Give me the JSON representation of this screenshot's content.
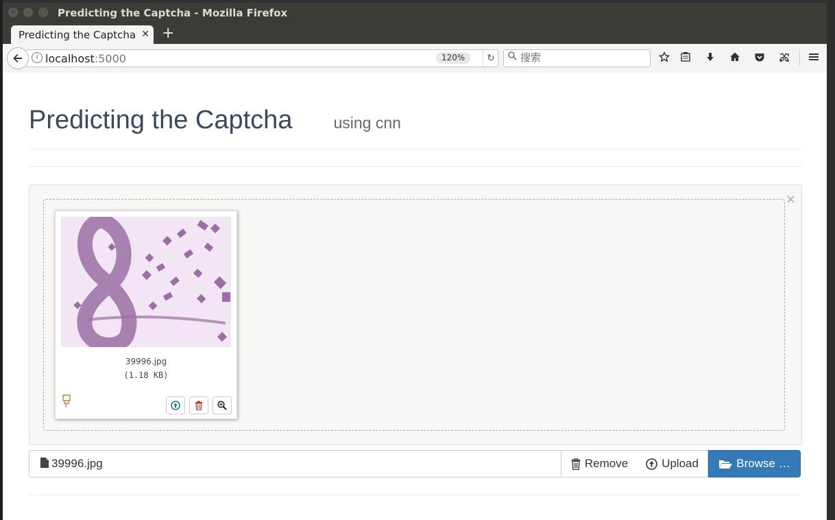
{
  "window": {
    "title": "Predicting the Captcha - Mozilla Firefox"
  },
  "tabs": [
    {
      "label": "Predicting the Captcha",
      "active": true
    }
  ],
  "navbar": {
    "url_host": "localhost",
    "url_port": ":5000",
    "zoom": "120%",
    "search_placeholder": "搜索"
  },
  "page": {
    "title": "Predicting the Captcha",
    "subtitle": "using cnn"
  },
  "preview": {
    "file_name": "39996.jpg",
    "file_size": "(1.18 KB)",
    "captcha_color": "#9b6fa3",
    "captcha_bg": "#f3e6f4"
  },
  "file_input": {
    "caption": "39996.jpg",
    "remove_label": "Remove",
    "upload_label": "Upload",
    "browse_label": "Browse …",
    "browse_color": "#337ab7"
  }
}
